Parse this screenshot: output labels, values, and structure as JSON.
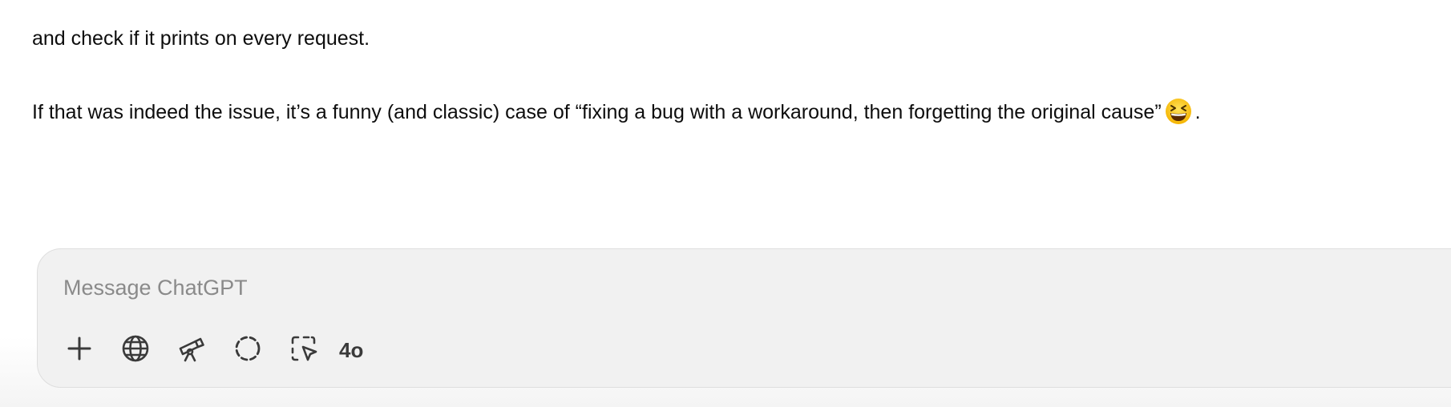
{
  "conversation": {
    "messages": [
      {
        "text": "and check if it prints on every request."
      },
      {
        "text": "If that was indeed the issue, it’s a funny (and classic) case of “fixing a bug with a workaround, then forgetting the original cause”",
        "trailing_emoji": "grinning-squinting-face-emoji",
        "trailing_text": "."
      }
    ]
  },
  "composer": {
    "placeholder": "Message ChatGPT",
    "value": "",
    "tools": [
      {
        "name": "add-attachment",
        "icon": "plus-icon"
      },
      {
        "name": "search-web",
        "icon": "globe-icon"
      },
      {
        "name": "deep-research",
        "icon": "telescope-icon"
      },
      {
        "name": "reason",
        "icon": "dashed-circle-icon"
      },
      {
        "name": "select-region",
        "icon": "cursor-select-icon"
      }
    ],
    "model_label": "4o"
  },
  "colors": {
    "composer_bg": "#f1f1f1",
    "composer_border": "#dedede",
    "placeholder": "#8a8a8a",
    "icon": "#3a3a3a",
    "text": "#0d0d0d"
  }
}
